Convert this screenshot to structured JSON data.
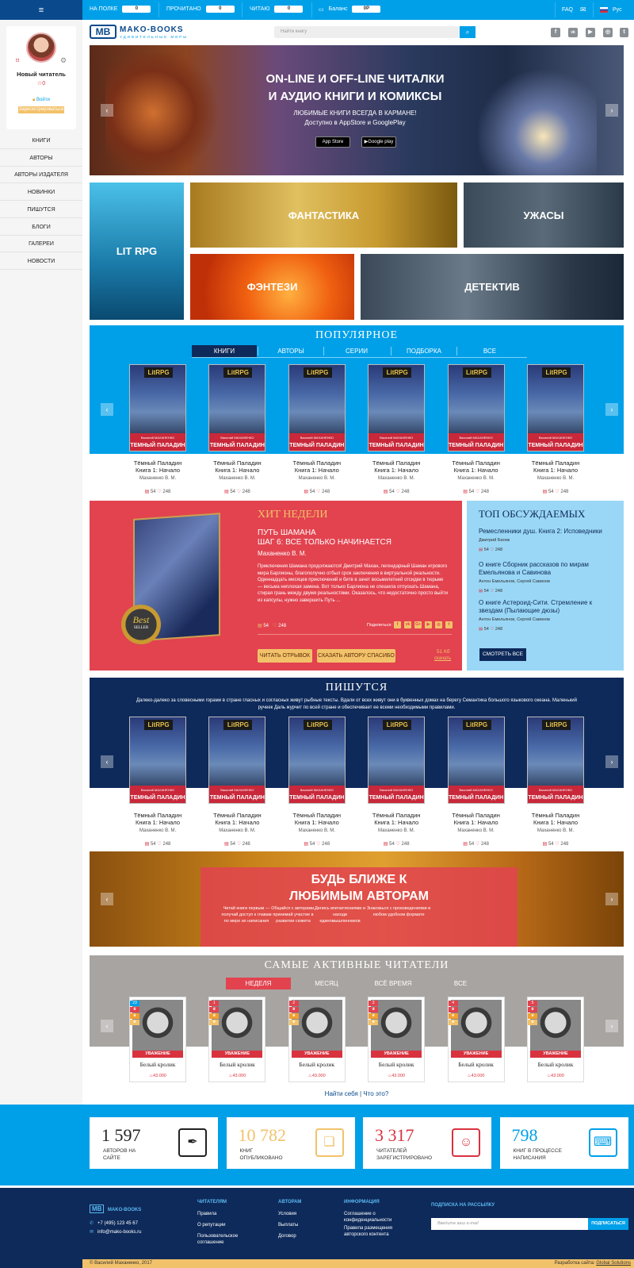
{
  "topbar": {
    "menu": "≡",
    "on_shelf": "НА ПОЛКЕ",
    "on_shelf_val": "0",
    "read": "ПРОЧИТАНО",
    "read_val": "0",
    "reading": "ЧИТАЮ",
    "reading_val": "0",
    "balance": "Баланс",
    "balance_val": "0Р",
    "faq": "FAQ",
    "lang": "Рус"
  },
  "user": {
    "name": "Новый читатель",
    "rating": "0",
    "login": "Войти",
    "register": "Зарегистрироваться"
  },
  "nav": [
    "КНИГИ",
    "АВТОРЫ",
    "АВТОРЫ ИЗДАТЕЛЯ",
    "НОВИНКИ",
    "ПИШУТСЯ",
    "БЛОГИ",
    "ГАЛЕРЕИ",
    "НОВОСТИ"
  ],
  "logo": {
    "name": "MAKO-BOOKS",
    "tagline": "УДИВИТЕЛЬНЫЕ МИРЫ",
    "mark": "МВ"
  },
  "search": {
    "placeholder": "Найти книгу"
  },
  "social": [
    "f",
    "vk",
    "▶",
    "◎",
    "t"
  ],
  "hero": {
    "line1": "ON-LINE И OFF-LINE ЧИТАЛКИ",
    "line2": "И АУДИО КНИГИ И КОМИКСЫ",
    "sub1": "ЛЮБИМЫЕ КНИГИ ВСЕГДА В КАРМАНЕ!",
    "sub2": "Доступно в AppStore и GooglePlay",
    "appstore": "App Store",
    "googleplay": "Google play"
  },
  "genres": {
    "litrpg": "LIT RPG",
    "fantastic": "ФАНТАСТИКА",
    "horror": "УЖАСЫ",
    "fantasy": "ФЭНТЕЗИ",
    "detective": "ДЕТЕКТИВ"
  },
  "popular": {
    "title": "ПОПУЛЯРНОЕ",
    "tabs": [
      "КНИГИ",
      "АВТОРЫ",
      "СЕРИИ",
      "ПОДБОРКА",
      "ВСЕ"
    ]
  },
  "book": {
    "tag": "LitRPG",
    "cover_title": "ТЕМНЫЙ ПАЛАДИН",
    "cover_author": "Василий МАХАНЕНКО",
    "title1": "Тёмный Паладин",
    "title2": "Книга 1: Начало",
    "author": "Маханенко В. М.",
    "comments": "54",
    "likes": "248"
  },
  "hit": {
    "title": "ХИТ НЕДЕЛИ",
    "book1": "ПУТЬ ШАМАНА",
    "book2": "ШАГ 6: ВСЕ ТОЛЬКО НАЧИНАЕТСЯ",
    "author": "Маханенко В. М.",
    "desc": "Приключения Шамана продолжаются! Дмитрий Махан, легендарный Шаман игрового мира Барлионы, благополучно отбыл срок заключения в виртуальной реальности. Одиннадцать месяцев приключений и битв в зачет восьмилетней отсидки в тюрьме — весьма неплохая замена. Вот только Барлиона не спешила отпускать Шамана, стирая грань между двумя реальностями. Оказалось, что недостаточно просто выйти из капсулы, нужно завершить Путь ...",
    "comments": "54",
    "likes": "248",
    "share": "Поделиться:",
    "read_btn": "ЧИТАТЬ ОТРЫВОК",
    "thanks_btn": "СКАЗАТЬ АВТОРУ СПАСИБО",
    "size": "51 Кб",
    "download": "скачать",
    "seal1": "Best",
    "seal2": "SELLER"
  },
  "topdisc": {
    "title": "ТОП ОБСУЖДАЕМЫХ",
    "items": [
      {
        "title": "Ремесленники душ. Книга 2: Исповедники",
        "author": "Дмитрий Билик",
        "c": "54",
        "l": "248"
      },
      {
        "title": "О книге Сборник рассказов по мирам Емельянова и Савинова",
        "author": "Антон Емельянов, Сергей Савинов",
        "c": "54",
        "l": "248"
      },
      {
        "title": "О книге Астероид-Сити. Стремление к звездам (Пылающие дюзы)",
        "author": "Антон Емельянов, Сергей Савинов",
        "c": "54",
        "l": "248"
      }
    ],
    "all_btn": "СМОТРЕТЬ ВСЕ"
  },
  "writing": {
    "title": "ПИШУТСЯ",
    "desc1": "Далеко-далеко за словесными горами в стране гласных и согласных живут рыбные тексты. Вдали от всех живут они в буквенных домах на берегу Семантика большого языкового океана. Маленький",
    "desc2": "ручеек Даль журчит по всей стране и обеспечивает ее всеми необходимыми правилами."
  },
  "closer": {
    "title1": "БУДЬ БЛИЖЕ К",
    "title2": "ЛЮБИМЫМ АВТОРАМ",
    "items": [
      "Читай книги первым — получай доступ к главам по мере их написания",
      "Общайся с авторами, принимай участие в развитии сюжета",
      "Делись впечатлениями и находи единомышленников",
      "Знакомься с произведениями в любом удобном формате"
    ]
  },
  "readers": {
    "title": "САМЫЕ АКТИВНЫЕ ЧИТАТЕЛИ",
    "tabs": [
      "НЕДЕЛЯ",
      "МЕСЯЦ",
      "ВСЁ ВРЕМЯ",
      "ВСЕ"
    ],
    "respect": "УВАЖЕНИЕ",
    "name": "Белый кролик",
    "score": "43.000",
    "ranks": [
      "23",
      "1",
      "2",
      "3",
      "4",
      "5"
    ],
    "find": "Найти себя",
    "what": "Что это?"
  },
  "stats": [
    {
      "num": "1 597",
      "l1": "АВТОРОВ НА",
      "l2": "САЙТЕ",
      "color": "#222",
      "icon": "✒"
    },
    {
      "num": "10 782",
      "l1": "КНИГ",
      "l2": "ОПУБЛИКОВАНО",
      "color": "#f2c26a",
      "icon": "❑"
    },
    {
      "num": "3 317",
      "l1": "ЧИТАТЕЛЕЙ",
      "l2": "ЗАРЕГИСТРИРОВАНО",
      "color": "#d9323f",
      "icon": "☺"
    },
    {
      "num": "798",
      "l1": "КНИГ В ПРОЦЕССЕ",
      "l2": "НАПИСАНИЯ",
      "color": "#00a0e9",
      "icon": "⌨"
    }
  ],
  "footer": {
    "phone": "+7 (495) 123 45 67",
    "email": "info@mako-books.ru",
    "readers_h": "ЧИТАТЕЛЯМ",
    "readers_links": [
      "Правила",
      "О репутации",
      "Пользовательское соглашение"
    ],
    "authors_h": "АВТОРАМ",
    "authors_links": [
      "Условия",
      "Выплаты",
      "Договор"
    ],
    "info_h": "ИНФОРМАЦИЯ",
    "info_links": [
      "Соглашение о конфиденциальности",
      "Правила размещения авторского контента"
    ],
    "subscribe_h": "ПОДПИСКА НА РАССЫЛКУ",
    "email_ph": "Введите ваш e-mail",
    "subscribe_btn": "ПОДПИСАТЬСЯ",
    "copyright": "© Василий Маханенко, 2017",
    "dev": "Разработка сайта:",
    "dev_link": "Global Solutions"
  }
}
